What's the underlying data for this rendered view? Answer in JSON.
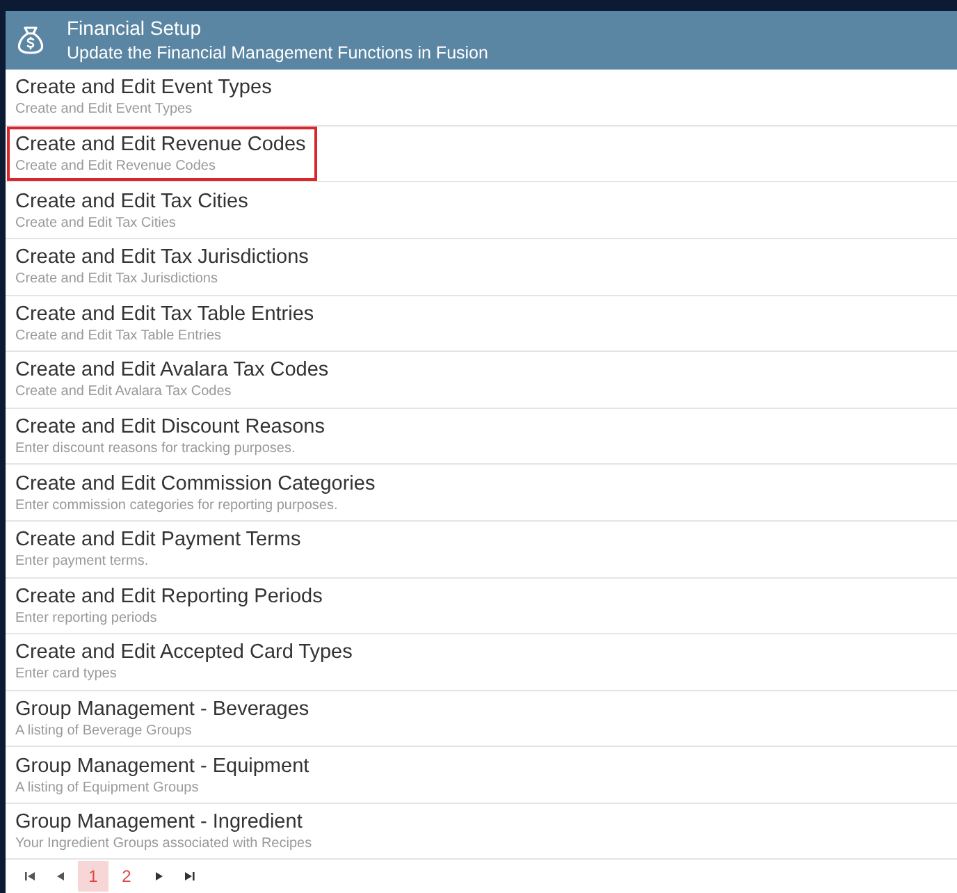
{
  "header": {
    "title": "Financial Setup",
    "subtitle": "Update the Financial Management Functions in Fusion"
  },
  "items": [
    {
      "title": "Create and Edit Event Types",
      "description": "Create and Edit Event Types",
      "highlighted": false
    },
    {
      "title": "Create and Edit Revenue Codes",
      "description": "Create and Edit Revenue Codes",
      "highlighted": true
    },
    {
      "title": "Create and Edit Tax Cities",
      "description": "Create and Edit Tax Cities",
      "highlighted": false
    },
    {
      "title": "Create and Edit Tax Jurisdictions",
      "description": "Create and Edit Tax Jurisdictions",
      "highlighted": false
    },
    {
      "title": "Create and Edit Tax Table Entries",
      "description": "Create and Edit Tax Table Entries",
      "highlighted": false
    },
    {
      "title": "Create and Edit Avalara Tax Codes",
      "description": "Create and Edit Avalara Tax Codes",
      "highlighted": false
    },
    {
      "title": "Create and Edit Discount Reasons",
      "description": "Enter discount reasons for tracking purposes.",
      "highlighted": false
    },
    {
      "title": "Create and Edit Commission Categories",
      "description": "Enter commission categories for reporting purposes.",
      "highlighted": false
    },
    {
      "title": "Create and Edit Payment Terms",
      "description": "Enter payment terms.",
      "highlighted": false
    },
    {
      "title": "Create and Edit Reporting Periods",
      "description": "Enter reporting periods",
      "highlighted": false
    },
    {
      "title": "Create and Edit Accepted Card Types",
      "description": "Enter card types",
      "highlighted": false
    },
    {
      "title": "Group Management - Beverages",
      "description": "A listing of Beverage Groups",
      "highlighted": false
    },
    {
      "title": "Group Management - Equipment",
      "description": "A listing of Equipment Groups",
      "highlighted": false
    },
    {
      "title": "Group Management - Ingredient",
      "description": "Your Ingredient Groups associated with Recipes",
      "highlighted": false
    }
  ],
  "pager": {
    "pages": [
      {
        "label": "1",
        "selected": true
      },
      {
        "label": "2",
        "selected": false
      }
    ]
  }
}
